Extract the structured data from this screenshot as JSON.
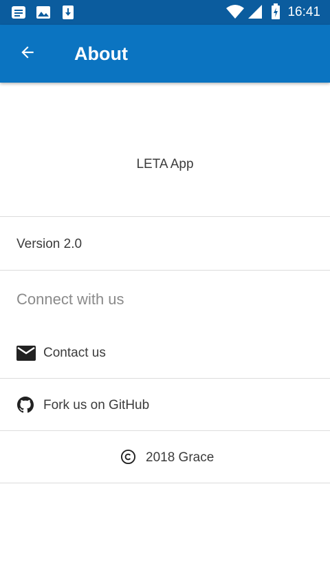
{
  "status_bar": {
    "icons": [
      "notification-icon",
      "image-icon",
      "download-icon",
      "wifi-icon",
      "signal-icon",
      "battery-icon"
    ],
    "time": "16:41"
  },
  "app_bar": {
    "back_icon": "arrow-left-icon",
    "title": "About"
  },
  "about": {
    "app_name": "LETA App",
    "version": "Version 2.0",
    "connect_header": "Connect with us",
    "contact": {
      "icon": "mail-icon",
      "label": "Contact us"
    },
    "github": {
      "icon": "github-icon",
      "label": "Fork us on GitHub"
    },
    "copyright": {
      "icon": "copyright-icon",
      "label": "2018 Grace"
    }
  },
  "colors": {
    "status_bar": "#0B5C9E",
    "app_bar": "#0B74C1",
    "text": "#3b3b3b",
    "section_header": "#8a8a8a",
    "divider": "#dcdcdc"
  }
}
